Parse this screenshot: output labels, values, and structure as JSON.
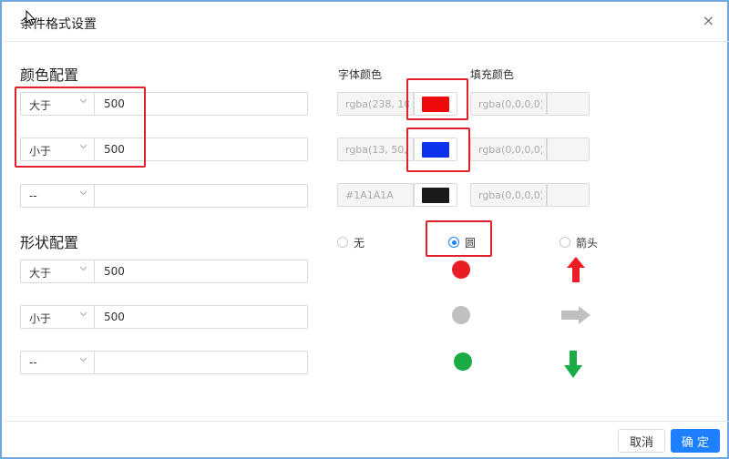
{
  "dialog": {
    "title": "条件格式设置",
    "close_glyph": "×"
  },
  "color_config": {
    "heading": "颜色配置",
    "font_color_label": "字体颜色",
    "fill_color_label": "填充颜色",
    "rows": [
      {
        "operator": "大于",
        "value": "500",
        "font_color_text": "rgba(238, 10",
        "font_color_hex": "#ee0a0a",
        "fill_color_text": "rgba(0,0,0,0)"
      },
      {
        "operator": "小于",
        "value": "500",
        "font_color_text": "rgba(13, 50,",
        "font_color_hex": "#0d32ee",
        "fill_color_text": "rgba(0,0,0,0)"
      },
      {
        "operator": "--",
        "value": "",
        "font_color_text": "#1A1A1A",
        "font_color_hex": "#1a1a1a",
        "fill_color_text": "rgba(0,0,0,0)"
      }
    ]
  },
  "shape_config": {
    "heading": "形状配置",
    "options": [
      {
        "label": "无",
        "checked": false
      },
      {
        "label": "圆",
        "checked": true
      },
      {
        "label": "箭头",
        "checked": false
      }
    ],
    "rows": [
      {
        "operator": "大于",
        "value": "500",
        "circle_color": "#ea1d25",
        "arrow": "arrow-up-icon",
        "arrow_color": "#ea1d25"
      },
      {
        "operator": "小于",
        "value": "500",
        "circle_color": "#c0c0c0",
        "arrow": "arrow-right-icon",
        "arrow_color": "#c0c0c0"
      },
      {
        "operator": "--",
        "value": "",
        "circle_color": "#1aab44",
        "arrow": "arrow-down-icon",
        "arrow_color": "#1aab44"
      }
    ]
  },
  "footer": {
    "cancel_label": "取消",
    "ok_label": "确 定"
  },
  "colors": {
    "accent": "#1e80ff",
    "highlight": "#e0202a",
    "frame_border": "#6fa8dc"
  }
}
